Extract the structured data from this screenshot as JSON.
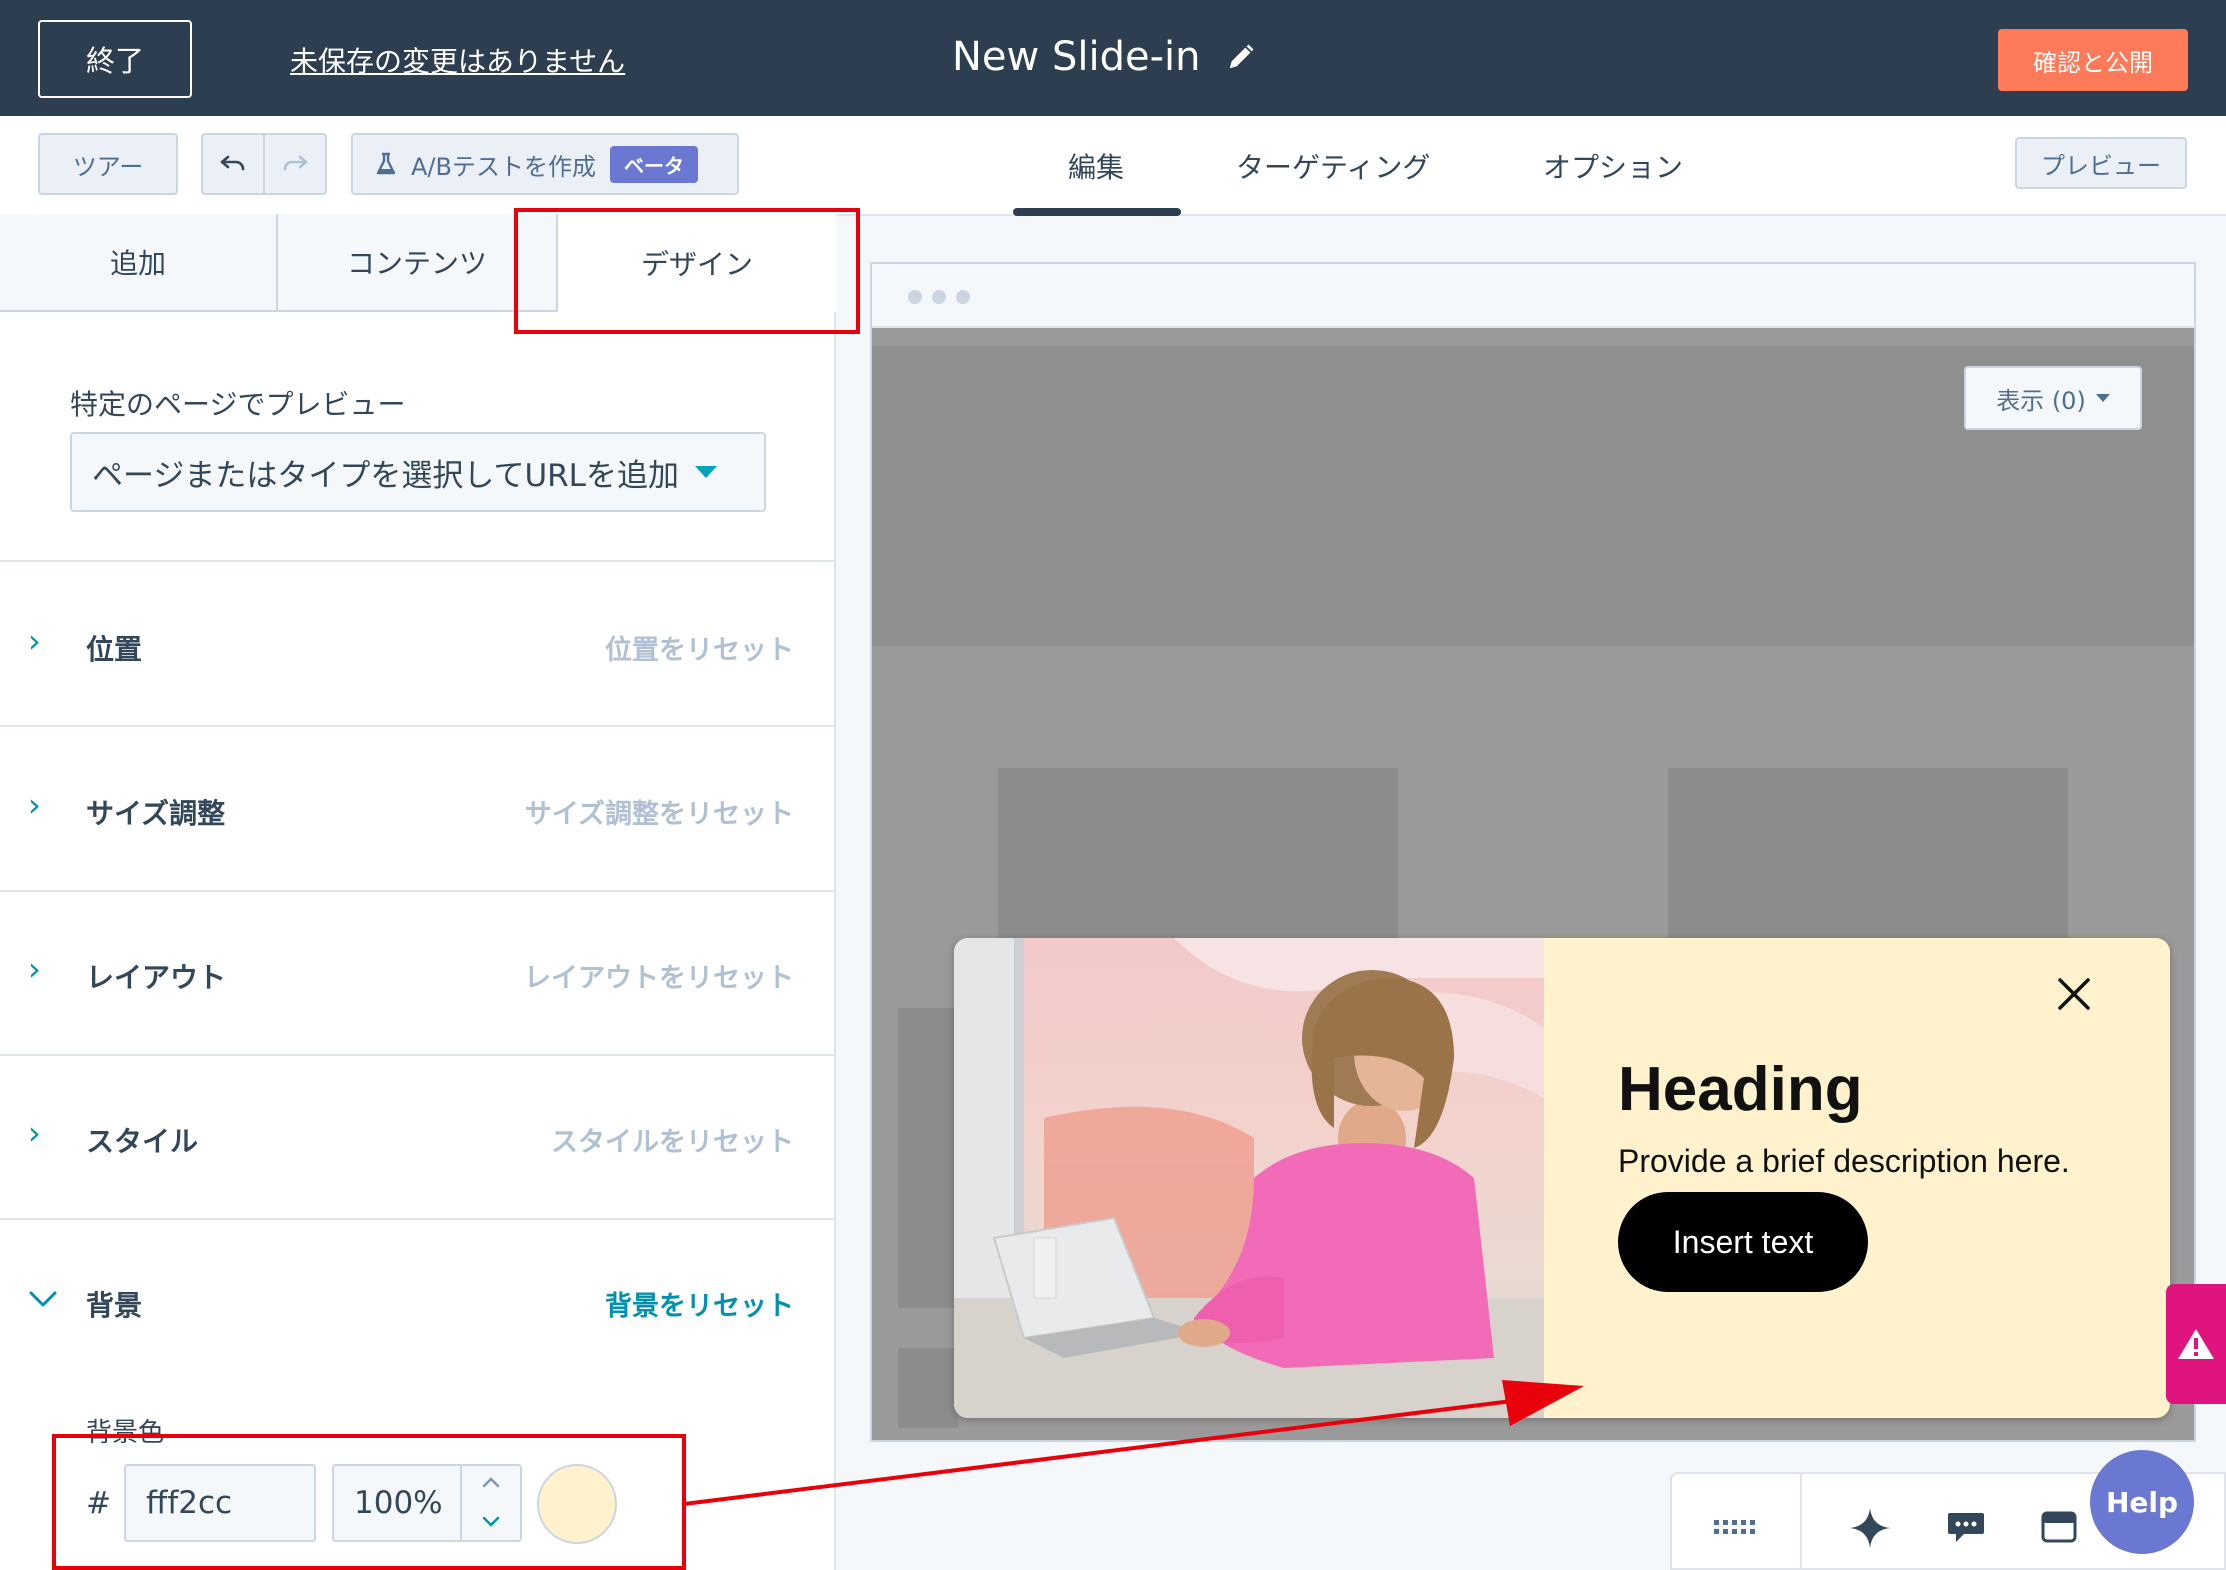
{
  "header": {
    "exit_label": "終了",
    "unsaved_label": "未保存の変更はありません",
    "title": "New Slide-in",
    "publish_label": "確認と公開"
  },
  "toolbar": {
    "tour_label": "ツアー",
    "ab_test_label": "A/Bテストを作成",
    "beta_label": "ベータ",
    "tabs": [
      {
        "label": "編集",
        "active": true
      },
      {
        "label": "ターゲティング",
        "active": false
      },
      {
        "label": "オプション",
        "active": false
      }
    ],
    "preview_label": "プレビュー"
  },
  "panel": {
    "tabs": [
      {
        "label": "追加"
      },
      {
        "label": "コンテンツ"
      },
      {
        "label": "デザイン",
        "active": true
      }
    ],
    "preview_on_page_label": "特定のページでプレビュー",
    "url_select_value": "ページまたはタイプを選択してURLを追加",
    "sections": [
      {
        "title": "位置",
        "reset": "位置をリセット",
        "expanded": false
      },
      {
        "title": "サイズ調整",
        "reset": "サイズ調整をリセット",
        "expanded": false
      },
      {
        "title": "レイアウト",
        "reset": "レイアウトをリセット",
        "expanded": false
      },
      {
        "title": "スタイル",
        "reset": "スタイルをリセット",
        "expanded": false
      },
      {
        "title": "背景",
        "reset": "背景をリセット",
        "expanded": true
      }
    ],
    "background": {
      "color_label": "背景色",
      "hash": "#",
      "hex_value": "fff2cc",
      "opacity_value": "100%",
      "swatch_color": "#fff2cc"
    }
  },
  "preview": {
    "show_label": "表示 (0)",
    "slidein": {
      "heading": "Heading",
      "description": "Provide a brief description here.",
      "cta_label": "Insert text",
      "background_color": "#fff2cc"
    }
  },
  "help_label": "Help",
  "colors": {
    "header_bg": "#2d3e50",
    "publish_bg": "#ff7a59",
    "accent": "#0091ae",
    "annotation_red": "#e8000b",
    "help_bg": "#6a78d1",
    "warning_bg": "#e0147e"
  }
}
